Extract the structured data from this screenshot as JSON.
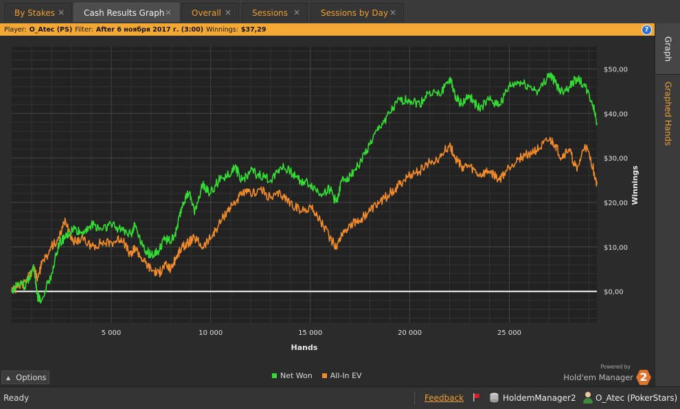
{
  "tabs": [
    {
      "label": "By Stakes",
      "active": false
    },
    {
      "label": "Cash Results Graph",
      "active": true
    },
    {
      "label": "Overall",
      "active": false
    },
    {
      "label": "Sessions",
      "active": false
    },
    {
      "label": "Sessions by Day",
      "active": false
    }
  ],
  "tab_close_glyph": "×",
  "infobar": {
    "player_label": "Player:",
    "player_value": "O_Atec (PS)",
    "filter_label": "Filter:",
    "filter_value": "After 6 ноября 2017 г. (3:00)",
    "winnings_label": "Winnings:",
    "winnings_value": "$37,29",
    "help_glyph": "?"
  },
  "side_tabs": {
    "graph": "Graph",
    "graphed_hands": "Graphed Hands"
  },
  "options_label": "Options",
  "legend": {
    "net_won": "Net Won",
    "all_in_ev": "All-In EV"
  },
  "powered": {
    "small": "Powered by",
    "brand": "Hold'em Manager",
    "logo": "2"
  },
  "status": {
    "ready": "Ready",
    "feedback": "Feedback",
    "db": "HoldemManager2",
    "user": "O_Atec (PokerStars)"
  },
  "colors": {
    "net_won": "#33dd33",
    "all_in_ev": "#f08a2a",
    "zero_line": "#ffffff",
    "accent": "#f0a030"
  },
  "chart_data": {
    "type": "line",
    "xlabel": "Hands",
    "ylabel": "Winnings",
    "xlim": [
      0,
      29400
    ],
    "ylim": [
      -7,
      55
    ],
    "x_ticks": [
      5000,
      10000,
      15000,
      20000,
      25000
    ],
    "x_tick_labels": [
      "5 000",
      "10 000",
      "15 000",
      "20 000",
      "25 000"
    ],
    "y_ticks": [
      0,
      10,
      20,
      30,
      40,
      50
    ],
    "y_tick_labels": [
      "$0,00",
      "$10,00",
      "$20,00",
      "$30,00",
      "$40,00",
      "$50,00"
    ],
    "grid": true,
    "legend_position": "bottom-center",
    "series": [
      {
        "name": "Net Won",
        "color": "#33dd33",
        "x": [
          0,
          300,
          700,
          1100,
          1300,
          1500,
          2000,
          2400,
          2700,
          3100,
          3500,
          4000,
          4500,
          5000,
          5500,
          6000,
          6200,
          6600,
          7000,
          7400,
          7700,
          8000,
          8300,
          8600,
          8900,
          9200,
          9600,
          10000,
          10400,
          10800,
          11200,
          11600,
          12000,
          12500,
          13000,
          13500,
          14000,
          14500,
          15000,
          15500,
          16000,
          16300,
          16600,
          17000,
          17500,
          18000,
          18500,
          19000,
          19500,
          20000,
          20500,
          21000,
          21500,
          22000,
          22300,
          22600,
          23000,
          23500,
          24000,
          24500,
          25000,
          25500,
          26000,
          26500,
          27000,
          27300,
          27600,
          28000,
          28400,
          28800,
          29200,
          29400
        ],
        "y": [
          0,
          2,
          1,
          6,
          -1,
          -2,
          4,
          11,
          12,
          14,
          13,
          15,
          14,
          15,
          14,
          13,
          15,
          10,
          8,
          9,
          12,
          11,
          14,
          20,
          22,
          18,
          24,
          22,
          25,
          26,
          28,
          25,
          27,
          26,
          25,
          28,
          27,
          25,
          24,
          22,
          23,
          20,
          25,
          26,
          29,
          33,
          37,
          40,
          43,
          43,
          42,
          45,
          44,
          48,
          44,
          42,
          44,
          41,
          43,
          42,
          46,
          47,
          46,
          45,
          49,
          47,
          45,
          46,
          48,
          46,
          42,
          38
        ]
      },
      {
        "name": "All-In EV",
        "color": "#f08a2a",
        "x": [
          0,
          300,
          700,
          1100,
          1300,
          1500,
          2000,
          2400,
          2700,
          3100,
          3500,
          4000,
          4500,
          5000,
          5500,
          6000,
          6200,
          6600,
          7000,
          7400,
          7700,
          8000,
          8300,
          8600,
          8900,
          9200,
          9600,
          10000,
          10400,
          10800,
          11200,
          11600,
          12000,
          12500,
          13000,
          13500,
          14000,
          14500,
          15000,
          15500,
          16000,
          16300,
          16600,
          17000,
          17500,
          18000,
          18500,
          19000,
          19500,
          20000,
          20500,
          21000,
          21500,
          22000,
          22300,
          22600,
          23000,
          23500,
          24000,
          24500,
          25000,
          25500,
          26000,
          26500,
          27000,
          27300,
          27600,
          28000,
          28400,
          28800,
          29200,
          29400
        ],
        "y": [
          0,
          1,
          2,
          5,
          3,
          6,
          10,
          12,
          16,
          11,
          12,
          10,
          11,
          11,
          12,
          8,
          10,
          7,
          5,
          4,
          6,
          5,
          8,
          10,
          11,
          12,
          10,
          12,
          15,
          18,
          20,
          22,
          22,
          23,
          21,
          22,
          20,
          18,
          19,
          16,
          12,
          10,
          13,
          15,
          16,
          18,
          20,
          22,
          24,
          26,
          27,
          29,
          30,
          33,
          30,
          28,
          28,
          26,
          27,
          25,
          28,
          30,
          31,
          32,
          34,
          33,
          30,
          32,
          27,
          33,
          28,
          24
        ]
      }
    ]
  }
}
